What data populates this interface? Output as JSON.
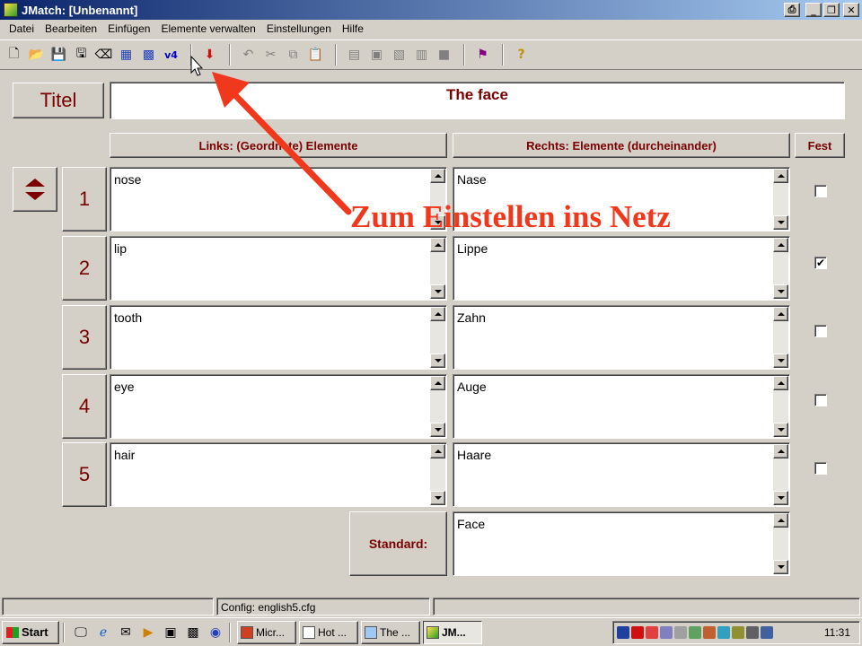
{
  "window": {
    "title": "JMatch: [Unbenannt]"
  },
  "menu": [
    "Datei",
    "Bearbeiten",
    "Einfügen",
    "Elemente verwalten",
    "Einstellungen",
    "Hilfe"
  ],
  "toolbar": {
    "v4_label": "v4"
  },
  "title_row": {
    "label": "Titel",
    "value": "The face"
  },
  "columns": {
    "left": "Links: (Geordnete) Elemente",
    "right": "Rechts: Elemente (durcheinander)",
    "fixed": "Fest"
  },
  "rows": [
    {
      "num": "1",
      "left": "nose",
      "right": "Nase",
      "fixed": false
    },
    {
      "num": "2",
      "left": "lip",
      "right": "Lippe",
      "fixed": true
    },
    {
      "num": "3",
      "left": "tooth",
      "right": "Zahn",
      "fixed": false
    },
    {
      "num": "4",
      "left": "eye",
      "right": "Auge",
      "fixed": false
    },
    {
      "num": "5",
      "left": "hair",
      "right": "Haare",
      "fixed": false
    }
  ],
  "standard": {
    "label": "Standard:",
    "value": "Face"
  },
  "status": {
    "config": "Config: english5.cfg"
  },
  "taskbar": {
    "start": "Start",
    "tasks": [
      "Micr...",
      "Hot ...",
      "The ...",
      "JM..."
    ],
    "clock": "11:31"
  },
  "annotation": {
    "text": "Zum Einstellen ins Netz",
    "color": "#f0381c"
  },
  "colors": {
    "label_red": "#7a0000",
    "titlebar": "#0a246a",
    "face": "#d4d0c8"
  }
}
